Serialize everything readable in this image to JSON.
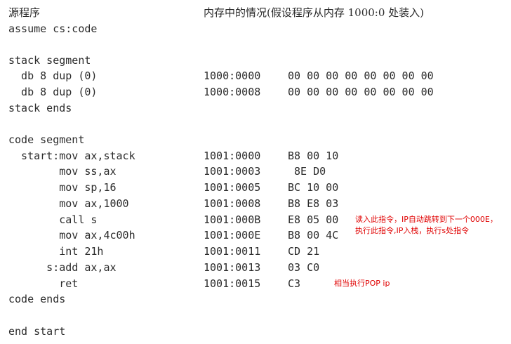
{
  "header": {
    "left": "源程序",
    "right": "内存中的情况(假设程序从内存 1000:0 处装入)"
  },
  "lines": [
    {
      "code": "assume cs:code",
      "addr": "",
      "bytes": ""
    },
    {
      "code": "",
      "addr": "",
      "bytes": ""
    },
    {
      "code": "stack segment",
      "addr": "",
      "bytes": ""
    },
    {
      "code": "  db 8 dup (0)",
      "addr": "1000:0000",
      "bytes": "00 00 00 00 00 00 00 00"
    },
    {
      "code": "  db 8 dup (0)",
      "addr": "1000:0008",
      "bytes": "00 00 00 00 00 00 00 00"
    },
    {
      "code": "stack ends",
      "addr": "",
      "bytes": ""
    },
    {
      "code": "",
      "addr": "",
      "bytes": ""
    },
    {
      "code": "code segment",
      "addr": "",
      "bytes": ""
    },
    {
      "code": "  start:mov ax,stack",
      "addr": "1001:0000",
      "bytes": "B8 00 10"
    },
    {
      "code": "        mov ss,ax",
      "addr": "1001:0003",
      "bytes": " 8E D0"
    },
    {
      "code": "        mov sp,16",
      "addr": "1001:0005",
      "bytes": "BC 10 00"
    },
    {
      "code": "        mov ax,1000",
      "addr": "1001:0008",
      "bytes": "B8 E8 03"
    },
    {
      "code": "        call s",
      "addr": "1001:000B",
      "bytes": "E8 05 00"
    },
    {
      "code": "        mov ax,4c00h",
      "addr": "1001:000E",
      "bytes": "B8 00 4C"
    },
    {
      "code": "        int 21h",
      "addr": "1001:0011",
      "bytes": "CD 21"
    },
    {
      "code": "      s:add ax,ax",
      "addr": "1001:0013",
      "bytes": "03 C0"
    },
    {
      "code": "        ret",
      "addr": "1001:0015",
      "bytes": "C3"
    },
    {
      "code": "code ends",
      "addr": "",
      "bytes": ""
    },
    {
      "code": "",
      "addr": "",
      "bytes": ""
    },
    {
      "code": "end start",
      "addr": "",
      "bytes": ""
    }
  ],
  "annotations": {
    "call_note_line1": "读入此指令，IP自动跳转到下一个000E，",
    "call_note_line2": "执行此指令,IP入栈，执行s处指令",
    "ret_note": "相当执行POP ip"
  },
  "colors": {
    "text": "#2b2b2b",
    "annotation": "#e00000"
  }
}
